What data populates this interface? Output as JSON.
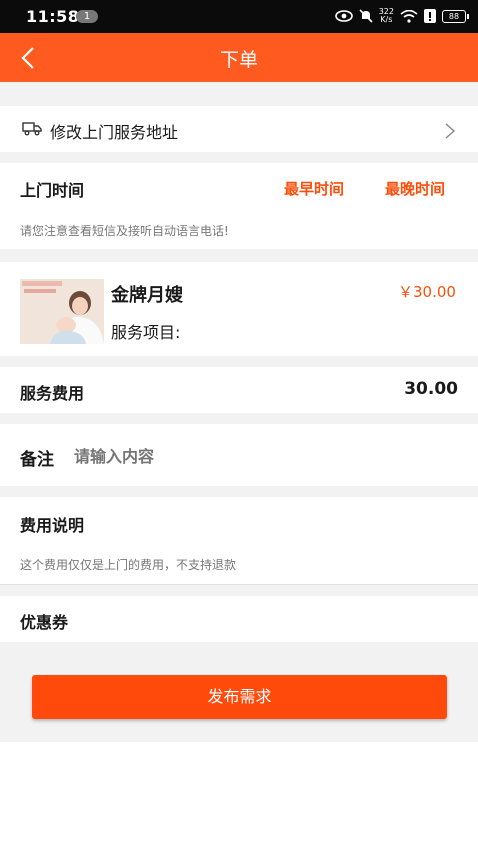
{
  "status_bar": {
    "time": "11:58",
    "notification_count": "1",
    "net_speed_value": "322",
    "net_speed_unit": "K/s",
    "battery": "88"
  },
  "header": {
    "title": "下单"
  },
  "address": {
    "label": "修改上门服务地址"
  },
  "visit_time": {
    "label": "上门时间",
    "earliest": "最早时间",
    "latest": "最晚时间",
    "hint": "请您注意查看短信及接听自动语言电话!"
  },
  "product": {
    "name": "金牌月嫂",
    "price": "￥30.00",
    "service_items_label": "服务项目:"
  },
  "fee": {
    "label": "服务费用",
    "value": "30.00"
  },
  "remark": {
    "label": "备注",
    "placeholder": "请输入内容"
  },
  "fee_note": {
    "label": "费用说明",
    "text": "这个费用仅仅是上门的费用，不支持退款"
  },
  "coupon": {
    "label": "优惠券"
  },
  "submit": {
    "label": "发布需求"
  },
  "colors": {
    "accent": "#ff5a1f",
    "button": "#ff4a0c",
    "background": "#f2f2f2"
  }
}
